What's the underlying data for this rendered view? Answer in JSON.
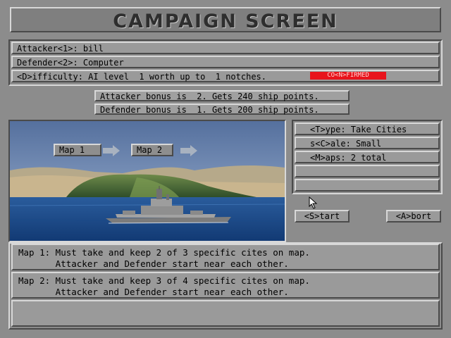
{
  "title": "CAMPAIGN SCREEN",
  "settings": {
    "attacker": "Attacker<1>: bill",
    "defender": "Defender<2>: Computer",
    "difficulty": "<D>ifficulty: AI level  1 worth up to  1 notches.",
    "confirmed": "CO<N>FIRMED"
  },
  "bonus": {
    "attacker": "Attacker bonus is  2. Gets 240 ship points.",
    "defender": "Defender bonus is  1. Gets 200 ship points."
  },
  "preview": {
    "map1": "Map 1",
    "map2": "Map 2"
  },
  "options": {
    "type": "<T>ype: Take Cities",
    "scale": "s<C>ale: Small",
    "maps": "<M>aps: 2 total",
    "empty1": "",
    "empty2": ""
  },
  "buttons": {
    "start": "<S>tart",
    "abort": "<A>bort"
  },
  "descriptions": {
    "map1": "Map 1: Must take and keep 2 of 3 specific cites on map.\n       Attacker and Defender start near each other.",
    "map2": "Map 2: Must take and keep 3 of 4 specific cites on map.\n       Attacker and Defender start near each other.",
    "map3": ""
  },
  "colors": {
    "confirmed_bg": "#e8141c",
    "sea": "#1f4f8f",
    "sky": "#6a88b8"
  }
}
